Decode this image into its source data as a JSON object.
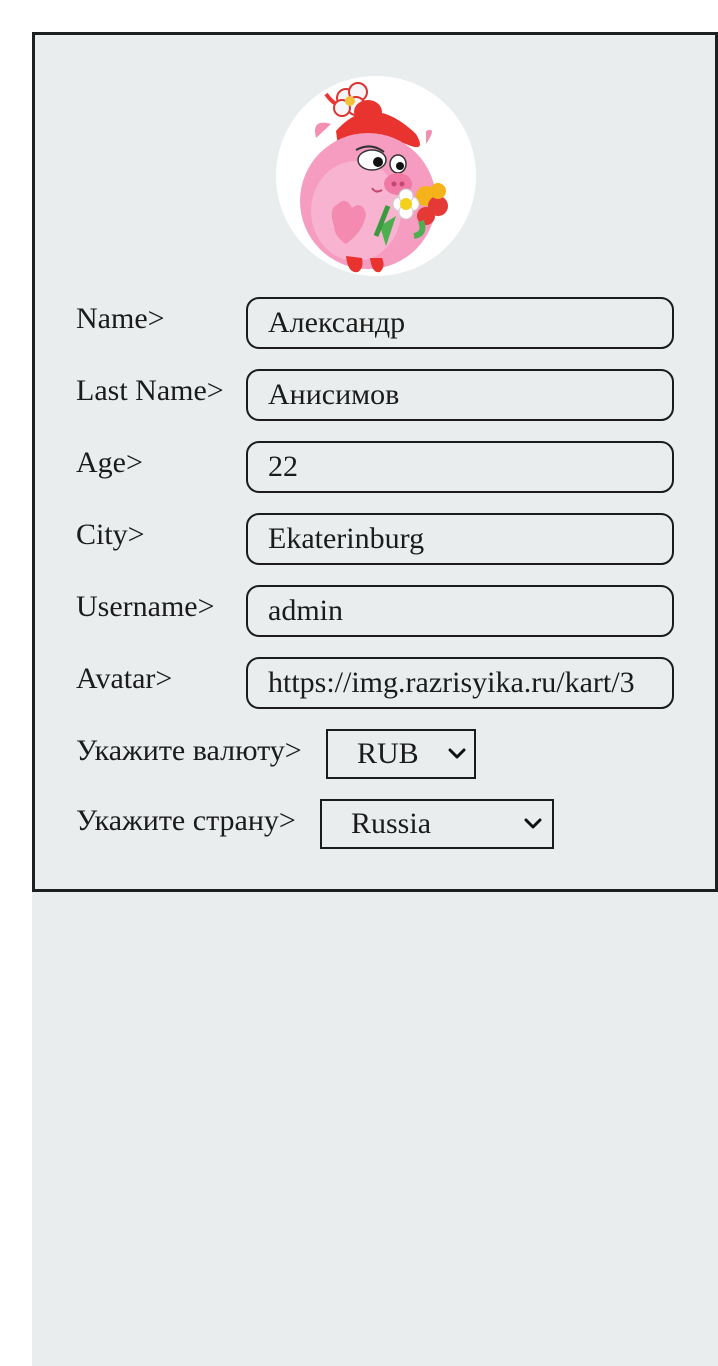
{
  "avatar": {
    "alt": "Nyusha pig avatar"
  },
  "fields": [
    {
      "label": "Name>",
      "value": "Александр"
    },
    {
      "label": "Last Name>",
      "value": "Анисимов"
    },
    {
      "label": "Age>",
      "value": "22"
    },
    {
      "label": "City>",
      "value": "Ekaterinburg"
    },
    {
      "label": "Username>",
      "value": "admin"
    },
    {
      "label": "Avatar>",
      "value": "https://img.razrisyika.ru/kart/3"
    }
  ],
  "currency": {
    "label": "Укажите валюту>",
    "selected": "RUB"
  },
  "country": {
    "label": "Укажите страну>",
    "selected": "Russia"
  },
  "icons": {
    "select_arrow": "chevron-down-icon"
  }
}
